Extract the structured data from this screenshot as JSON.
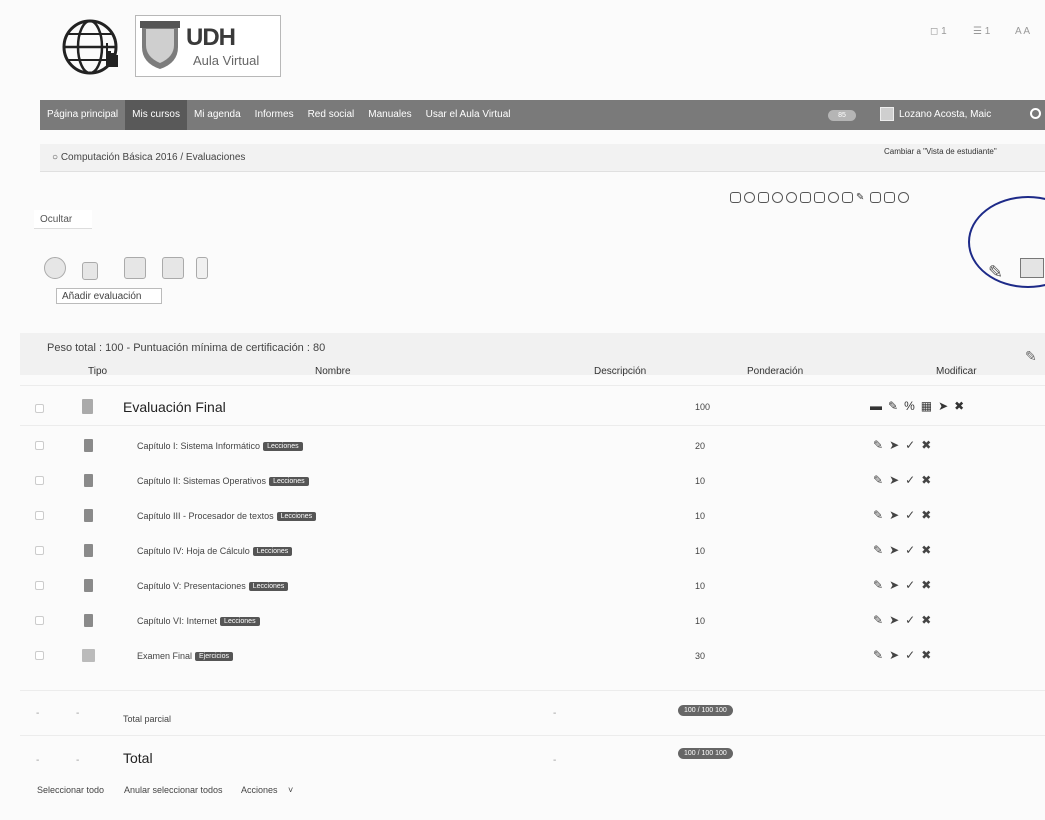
{
  "header": {
    "brand": "UDH",
    "subtitle": "Aula Virtual",
    "shield_text": "UDH",
    "top_right": {
      "bell_count": "1",
      "msg_count": "1",
      "font_size": "A A"
    }
  },
  "nav": {
    "items": [
      "Página principal",
      "Mis cursos",
      "Mi agenda",
      "Informes",
      "Red social",
      "Manuales",
      "Usar el Aula Virtual"
    ],
    "badge": "85",
    "user": "Lozano Acosta, Maic"
  },
  "breadcrumb": {
    "course": "Computación Básica 2016",
    "separator": "/",
    "page": "Evaluaciones"
  },
  "student_view_label": "Cambiar a \"Vista de estudiante\"",
  "ocultar_label": "Ocultar",
  "tooltip": "Añadir evaluación",
  "weight_summary": "Peso total : 100 - Puntuación mínima de certificación : 80",
  "table": {
    "headers": [
      "Tipo",
      "Nombre",
      "Descripción",
      "Ponderación",
      "Modificar"
    ],
    "final": {
      "name": "Evaluación Final",
      "weight": "100"
    },
    "rows": [
      {
        "name": "Capítulo I: Sistema Informático",
        "tag": "Lecciones",
        "weight": "20"
      },
      {
        "name": "Capítulo II: Sistemas Operativos",
        "tag": "Lecciones",
        "weight": "10"
      },
      {
        "name": "Capítulo III - Procesador de textos",
        "tag": "Lecciones",
        "weight": "10"
      },
      {
        "name": "Capítulo IV: Hoja de Cálculo",
        "tag": "Lecciones",
        "weight": "10"
      },
      {
        "name": "Capítulo V: Presentaciones",
        "tag": "Lecciones",
        "weight": "10"
      },
      {
        "name": "Capítulo VI: Internet",
        "tag": "Lecciones",
        "weight": "10"
      },
      {
        "name": "Examen Final",
        "tag": "Ejercicios",
        "weight": "30"
      }
    ],
    "partial": {
      "label": "Total parcial",
      "dash1": "-",
      "dash2": "-",
      "desc": "-",
      "badge": "100 / 100   100"
    },
    "total": {
      "label": "Total",
      "dash1": "-",
      "dash2": "-",
      "desc": "-",
      "badge": "100 / 100   100"
    }
  },
  "footer": {
    "select_all": "Seleccionar todo",
    "deselect_all": "Anular seleccionar todos",
    "actions": "Acciones"
  }
}
